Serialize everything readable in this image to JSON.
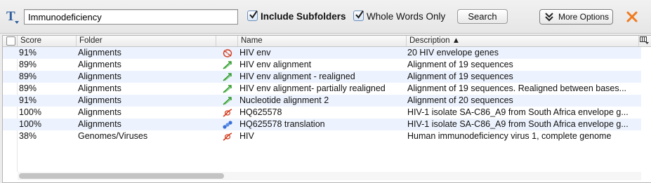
{
  "toolbar": {
    "search_value": "Immunodeficiency",
    "include_subfolders_label": "Include Subfolders",
    "include_subfolders_checked": true,
    "whole_words_label": "Whole Words Only",
    "whole_words_checked": true,
    "search_button_label": "Search",
    "more_options_label": "More Options",
    "close_icon": "close-x-icon",
    "type_icon": "text-type-icon"
  },
  "table": {
    "columns": {
      "score": "Score",
      "folder": "Folder",
      "name": "Name",
      "description": "Description ▲"
    },
    "rows": [
      {
        "score": "91%",
        "folder": "Alignments",
        "icon": "circular-sequence-icon",
        "name": "HIV env",
        "description": "20 HIV envelope genes"
      },
      {
        "score": "89%",
        "folder": "Alignments",
        "icon": "alignment-icon",
        "name": "HIV env alignment",
        "description": "Alignment of 19 sequences"
      },
      {
        "score": "89%",
        "folder": "Alignments",
        "icon": "alignment-icon",
        "name": "HIV env alignment - realigned",
        "description": "Alignment of 19 sequences"
      },
      {
        "score": "89%",
        "folder": "Alignments",
        "icon": "alignment-icon",
        "name": "HIV env alignment- partially realigned",
        "description": "Alignment of 19 sequences. Realigned between bases..."
      },
      {
        "score": "91%",
        "folder": "Alignments",
        "icon": "alignment-icon",
        "name": "Nucleotide alignment 2",
        "description": "Alignment of 20 sequences"
      },
      {
        "score": "100%",
        "folder": "Alignments",
        "icon": "dna-sequence-icon",
        "name": "HQ625578",
        "description": "HIV-1 isolate SA-C86_A9 from South Africa envelope g..."
      },
      {
        "score": "100%",
        "folder": "Alignments",
        "icon": "protein-translation-icon",
        "name": "HQ625578 translation",
        "description": "HIV-1 isolate SA-C86_A9 from South Africa envelope g..."
      },
      {
        "score": "38%",
        "folder": "Genomes/Viruses",
        "icon": "dna-sequence-icon",
        "name": "HIV",
        "description": "Human immunodeficiency virus 1, complete genome"
      }
    ]
  },
  "colors": {
    "row_alt": "#edf3fe",
    "close_accent": "#f07a1f",
    "alignment_icon": "#2e9a2a",
    "sequence_icon": "#d23a1e",
    "translation_icon": "#3a6fd6"
  }
}
